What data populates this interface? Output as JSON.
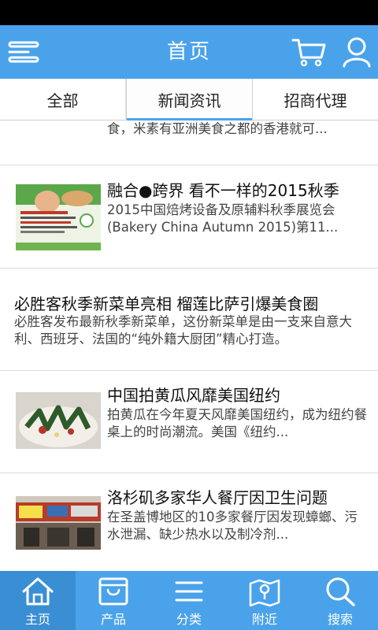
{
  "header": {
    "title": "首页",
    "menu_icon": "menu-icon",
    "cart_icon": "cart-icon",
    "user_icon": "user-icon",
    "accent_color": "#4aa3ea"
  },
  "tabs": [
    {
      "label": "全部",
      "active": false
    },
    {
      "label": "新闻资讯",
      "active": true
    },
    {
      "label": "招商代理",
      "active": false
    }
  ],
  "news": [
    {
      "title": "",
      "desc": "食，米素有亚洲美食之都的香港就可..."
    },
    {
      "title": "融合●跨界 看不一样的2015秋季",
      "desc": "2015中国焙烤设备及原辅料秋季展览会(Bakery China Autumn 2015)第11..."
    },
    {
      "title": "必胜客秋季新菜单亮相 榴莲比萨引爆美食圈",
      "desc": "必胜客发布最新秋季新菜单，这份新菜单是由一支来自意大利、西班牙、法国的“纯外籍大厨团”精心打造。"
    },
    {
      "title": "中国拍黄瓜风靡美国纽约",
      "desc": "拍黄瓜在今年夏天风靡美国纽约，成为纽约餐桌上的时尚潮流。美国《纽约..."
    },
    {
      "title": "洛杉矶多家华人餐厅因卫生问题",
      "desc": "在圣盖博地区的10多家餐厅因发现蟑螂、污水泄漏、缺少热水以及制冷剂..."
    }
  ],
  "bottom_nav": [
    {
      "label": "主页",
      "icon": "home-icon",
      "active": true
    },
    {
      "label": "产品",
      "icon": "product-bag-icon",
      "active": false
    },
    {
      "label": "分类",
      "icon": "category-list-icon",
      "active": false
    },
    {
      "label": "附近",
      "icon": "map-icon",
      "active": false
    },
    {
      "label": "搜索",
      "icon": "search-icon",
      "active": false
    }
  ]
}
